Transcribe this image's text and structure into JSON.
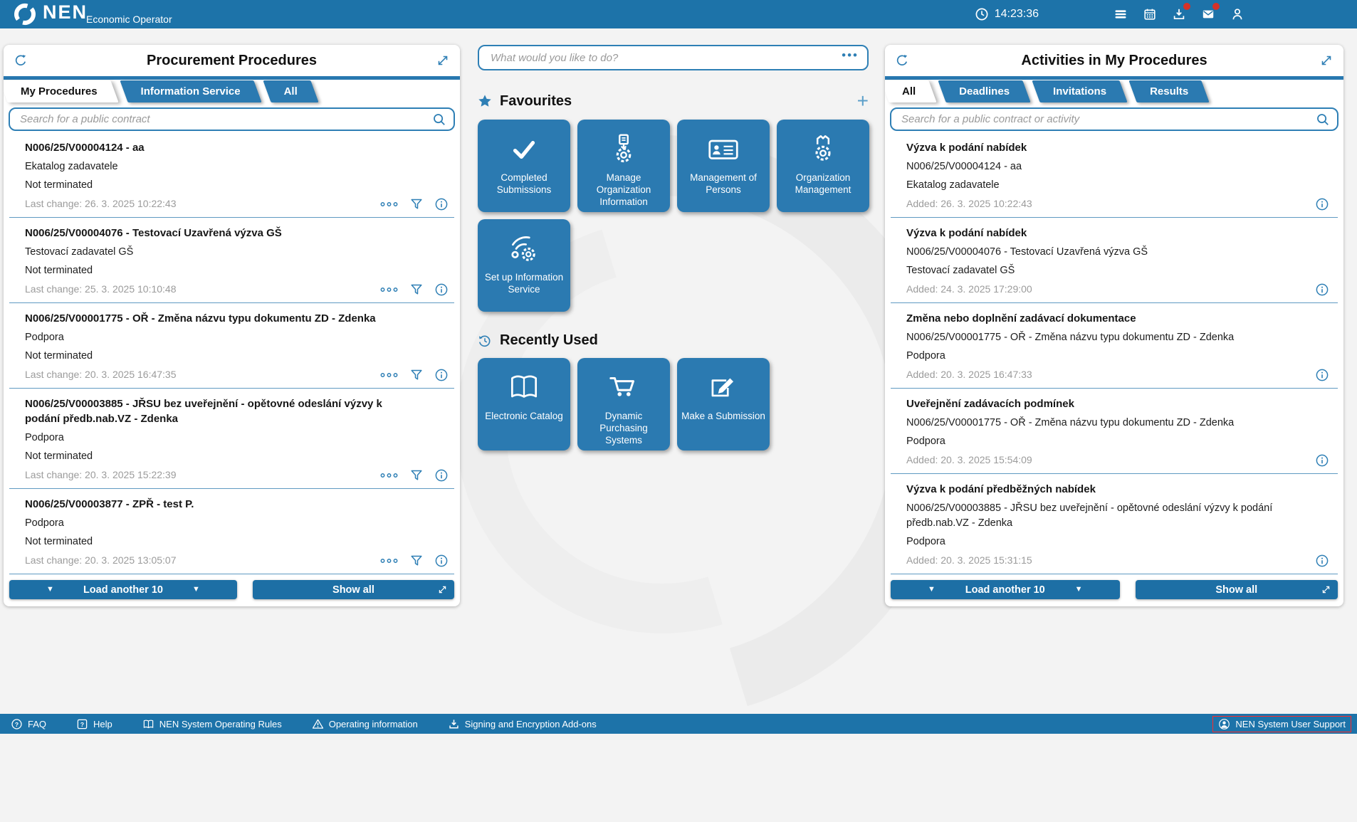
{
  "topbar": {
    "brand": "NEN",
    "subtitle": "Economic Operator",
    "time": "14:23:36"
  },
  "icons_text": {
    "triangle_down": "▼",
    "plus": "+",
    "ellipsis": "•••"
  },
  "left_panel": {
    "title": "Procurement Procedures",
    "tabs": [
      "My Procedures",
      "Information Service",
      "All"
    ],
    "search_placeholder": "Search for a public contract",
    "items": [
      {
        "title": "N006/25/V00004124 - aa",
        "org": "Ekatalog zadavatele",
        "status": "Not terminated",
        "meta": "Last change: 26. 3. 2025 10:22:43"
      },
      {
        "title": "N006/25/V00004076 - Testovací Uzavřená výzva GŠ",
        "org": "Testovací zadavatel GŠ",
        "status": "Not terminated",
        "meta": "Last change: 25. 3. 2025 10:10:48"
      },
      {
        "title": "N006/25/V00001775 - OŘ - Změna názvu typu dokumentu ZD - Zdenka",
        "org": "Podpora",
        "status": "Not terminated",
        "meta": "Last change: 20. 3. 2025 16:47:35"
      },
      {
        "title": "N006/25/V00003885 - JŘSU bez uveřejnění - opětovné odeslání výzvy k podání předb.nab.VZ - Zdenka",
        "org": "Podpora",
        "status": "Not terminated",
        "meta": "Last change: 20. 3. 2025 15:22:39"
      },
      {
        "title": "N006/25/V00003877 - ZPŘ - test P.",
        "org": "Podpora",
        "status": "Not terminated",
        "meta": "Last change: 20. 3. 2025 13:05:07"
      }
    ],
    "load_more_label": "Load another 10",
    "show_all_label": "Show all"
  },
  "center": {
    "search_placeholder": "What would you like to do?",
    "favourites": {
      "title": "Favourites",
      "tiles": [
        "Completed Submissions",
        "Manage Organization Information",
        "Management of Persons",
        "Organization Management",
        "Set up Information Service"
      ]
    },
    "recently_used": {
      "title": "Recently Used",
      "tiles": [
        "Electronic Catalog",
        "Dynamic Purchasing Systems",
        "Make a Submission"
      ]
    }
  },
  "right_panel": {
    "title": "Activities in My Procedures",
    "tabs": [
      "All",
      "Deadlines",
      "Invitations",
      "Results"
    ],
    "search_placeholder": "Search for a public contract or activity",
    "items": [
      {
        "title": "Výzva k podání nabídek",
        "contract": "N006/25/V00004124 - aa",
        "org": "Ekatalog zadavatele",
        "meta": "Added: 26. 3. 2025 10:22:43"
      },
      {
        "title": "Výzva k podání nabídek",
        "contract": "N006/25/V00004076 - Testovací Uzavřená výzva GŠ",
        "org": "Testovací zadavatel GŠ",
        "meta": "Added: 24. 3. 2025 17:29:00"
      },
      {
        "title": "Změna nebo doplnění zadávací dokumentace",
        "contract": "N006/25/V00001775 - OŘ - Změna názvu typu dokumentu ZD - Zdenka",
        "org": "Podpora",
        "meta": "Added: 20. 3. 2025 16:47:33"
      },
      {
        "title": "Uveřejnění zadávacích podmínek",
        "contract": "N006/25/V00001775 - OŘ - Změna názvu typu dokumentu ZD - Zdenka",
        "org": "Podpora",
        "meta": "Added: 20. 3. 2025 15:54:09"
      },
      {
        "title": "Výzva k podání předběžných nabídek",
        "contract": "N006/25/V00003885 - JŘSU bez uveřejnění - opětovné odeslání výzvy k podání předb.nab.VZ - Zdenka",
        "org": "Podpora",
        "meta": "Added: 20. 3. 2025 15:31:15"
      }
    ],
    "load_more_label": "Load another 10",
    "show_all_label": "Show all"
  },
  "footer": {
    "faq": "FAQ",
    "help": "Help",
    "rules": "NEN System Operating Rules",
    "info": "Operating information",
    "addons": "Signing and Encryption Add-ons",
    "support": "NEN System User Support"
  },
  "colors": {
    "topbar": "#1d73a9",
    "tile": "#2b7ab1",
    "accent": "#2e7fb5",
    "badge": "#d63128"
  }
}
